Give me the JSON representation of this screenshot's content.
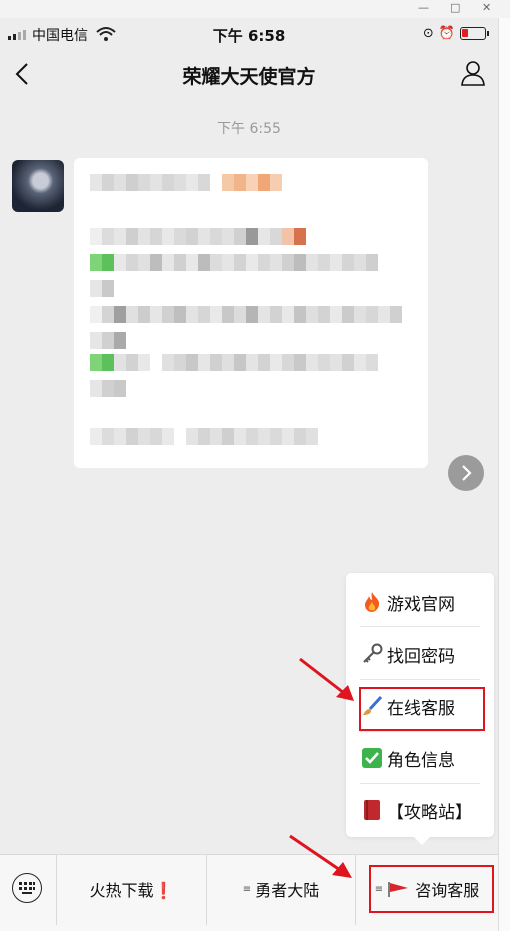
{
  "status_bar": {
    "carrier": "中国电信",
    "time": "下午 6:58"
  },
  "nav": {
    "title": "荣耀大天使官方"
  },
  "chat": {
    "timestamp": "下午 6:55"
  },
  "menu": {
    "items": [
      {
        "label": "游戏官网",
        "icon": "fire-icon"
      },
      {
        "label": "找回密码",
        "icon": "key-icon"
      },
      {
        "label": "在线客服",
        "icon": "paintbrush-icon"
      },
      {
        "label": "角色信息",
        "icon": "check-mark-icon"
      },
      {
        "label": "【攻略站】",
        "icon": "book-icon"
      }
    ]
  },
  "bottom_bar": {
    "tabs": [
      {
        "label": "火热下载❗"
      },
      {
        "label": "勇者大陆"
      },
      {
        "label": "咨询客服"
      }
    ]
  },
  "colors": {
    "highlight": "#e0141e",
    "background": "#ededed"
  }
}
